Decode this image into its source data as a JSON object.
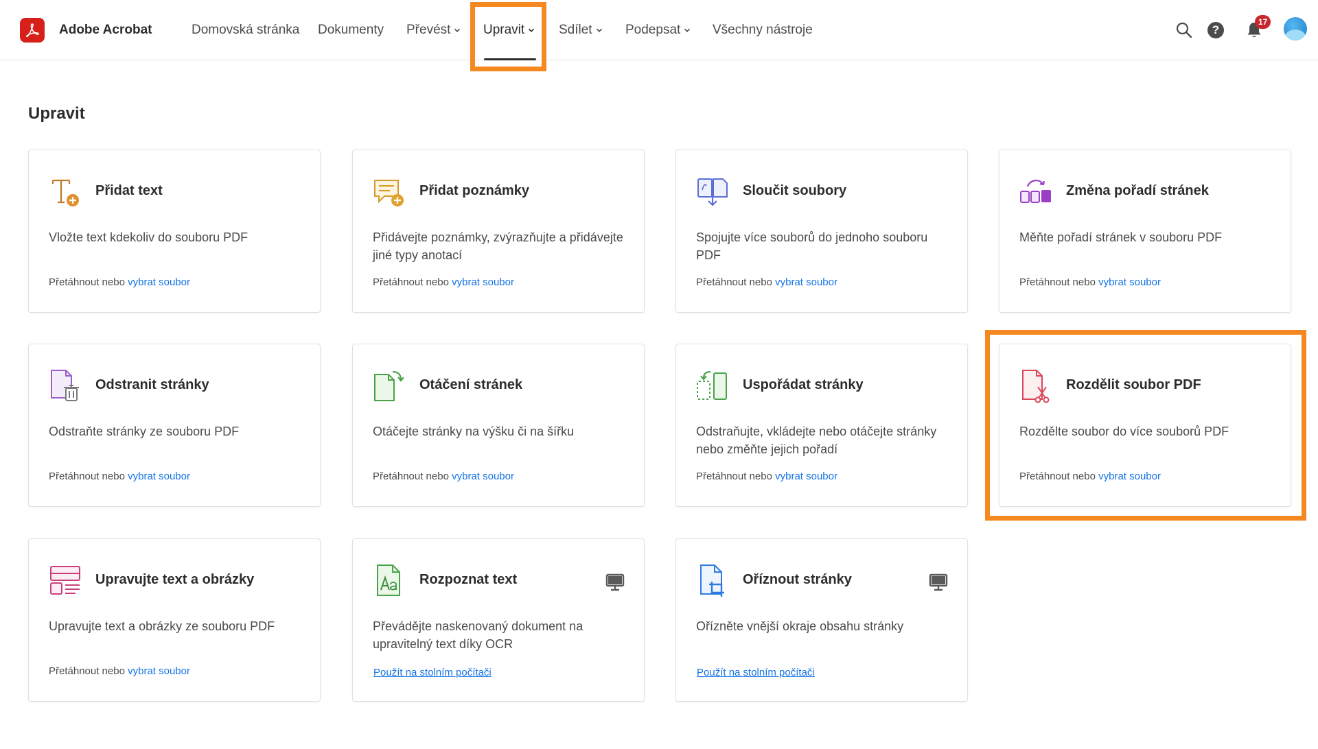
{
  "app": {
    "name": "Adobe Acrobat"
  },
  "nav": {
    "items": [
      {
        "label": "Domovská stránka"
      },
      {
        "label": "Dokumenty"
      },
      {
        "label": "Převést"
      },
      {
        "label": "Upravit"
      },
      {
        "label": "Sdílet"
      },
      {
        "label": "Podepsat"
      },
      {
        "label": "Všechny nástroje"
      }
    ],
    "active": "Upravit",
    "notification_count": "17"
  },
  "page": {
    "title": "Upravit"
  },
  "tools": [
    {
      "title": "Přidat text",
      "desc": "Vložte text kdekoliv do souboru PDF",
      "foot_prefix": "Přetáhnout nebo",
      "foot_link": "vybrat soubor",
      "icon": "add-text-icon"
    },
    {
      "title": "Přidat poznámky",
      "desc": "Přidávejte poznámky, zvýrazňujte a přidávejte jiné typy anotací",
      "foot_prefix": "Přetáhnout nebo",
      "foot_link": "vybrat soubor",
      "icon": "add-comment-icon"
    },
    {
      "title": "Sloučit soubory",
      "desc": "Spojujte více souborů do jednoho souboru PDF",
      "foot_prefix": "Přetáhnout nebo",
      "foot_link": "vybrat soubor",
      "icon": "combine-files-icon"
    },
    {
      "title": "Změna pořadí stránek",
      "desc": "Měňte pořadí stránek v souboru PDF",
      "foot_prefix": "Přetáhnout nebo",
      "foot_link": "vybrat soubor",
      "icon": "reorder-pages-icon"
    },
    {
      "title": "Odstranit stránky",
      "desc": "Odstraňte stránky ze souboru PDF",
      "foot_prefix": "Přetáhnout nebo",
      "foot_link": "vybrat soubor",
      "icon": "delete-pages-icon"
    },
    {
      "title": "Otáčení stránek",
      "desc": "Otáčejte stránky na výšku či na šířku",
      "foot_prefix": "Přetáhnout nebo",
      "foot_link": "vybrat soubor",
      "icon": "rotate-pages-icon"
    },
    {
      "title": "Uspořádat stránky",
      "desc": "Odstraňujte, vkládejte nebo otáčejte stránky nebo změňte jejich pořadí",
      "foot_prefix": "Přetáhnout nebo",
      "foot_link": "vybrat soubor",
      "icon": "organize-pages-icon"
    },
    {
      "title": "Rozdělit soubor PDF",
      "desc": "Rozdělte soubor do více souborů PDF",
      "foot_prefix": "Přetáhnout nebo",
      "foot_link": "vybrat soubor",
      "icon": "split-pdf-icon"
    },
    {
      "title": "Upravujte text a obrázky",
      "desc": "Upravujte text a obrázky ze souboru PDF",
      "foot_prefix": "Přetáhnout nebo",
      "foot_link": "vybrat soubor",
      "icon": "edit-text-images-icon"
    },
    {
      "title": "Rozpoznat text",
      "desc": "Převádějte naskenovaný dokument na upravitelný text díky OCR",
      "desktop_link": "Použít na stolním počítači",
      "icon": "recognize-text-icon"
    },
    {
      "title": "Oříznout stránky",
      "desc": "Ořízněte vnější okraje obsahu stránky",
      "desktop_link": "Použít na stolním počítači",
      "icon": "crop-pages-icon"
    }
  ],
  "colors": {
    "highlight": "#f5891f",
    "link": "#1473e6",
    "acrobat_red": "#d8201b"
  }
}
